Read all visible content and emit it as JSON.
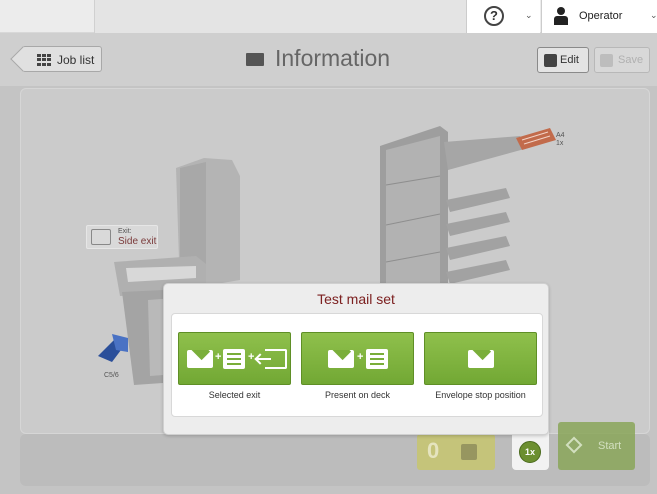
{
  "topbar": {
    "help_icon": "help-circle-icon",
    "operator_label": "Operator"
  },
  "header": {
    "joblist_label": "Job list",
    "title": "Information",
    "edit_label": "Edit",
    "save_label": "Save"
  },
  "machine": {
    "exit_small": "Exit:",
    "exit_value": "Side exit",
    "feeder_paper": "A4",
    "feeder_count": "1x",
    "envelope_size": "C5/6"
  },
  "bottom": {
    "counter_value": "0",
    "count_badge": "1x",
    "start_label": "Start"
  },
  "popup": {
    "title": "Test mail set",
    "actions": [
      {
        "label": "Selected exit",
        "icon": "envelope-document-exit-icon"
      },
      {
        "label": "Present on deck",
        "icon": "envelope-document-icon"
      },
      {
        "label": "Envelope stop position",
        "icon": "envelope-icon"
      }
    ]
  },
  "colors": {
    "accent_green": "#7aae3a",
    "title_red": "#7c2020",
    "counter_yellow": "#c8c66a"
  }
}
